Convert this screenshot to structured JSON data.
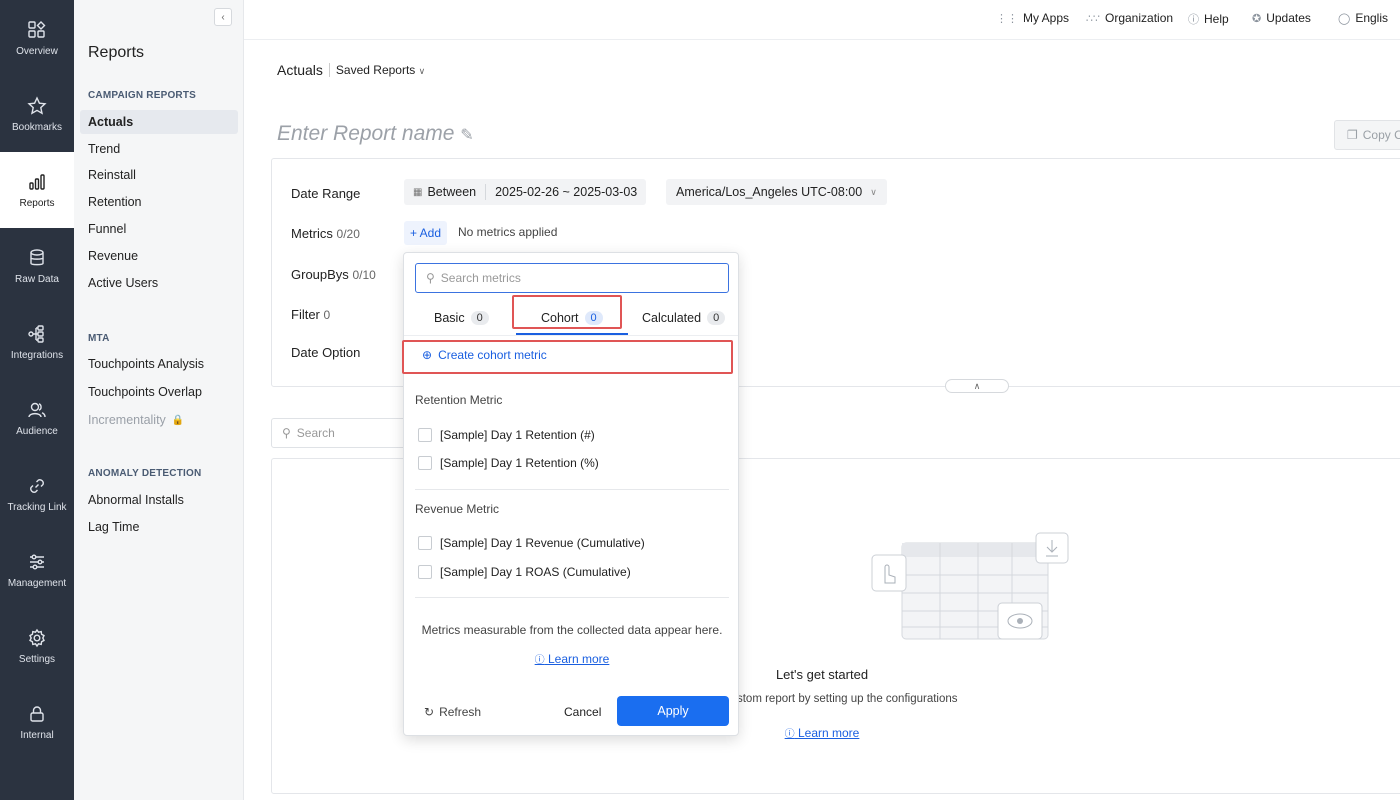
{
  "rail": {
    "items": [
      {
        "label": "Overview",
        "icon": "overview-icon"
      },
      {
        "label": "Bookmarks",
        "icon": "star-icon"
      },
      {
        "label": "Reports",
        "icon": "bar-chart-icon"
      },
      {
        "label": "Raw Data",
        "icon": "database-icon"
      },
      {
        "label": "Integrations",
        "icon": "integrations-icon"
      },
      {
        "label": "Audience",
        "icon": "audience-icon"
      },
      {
        "label": "Tracking Link",
        "icon": "link-icon"
      },
      {
        "label": "Management",
        "icon": "sliders-icon"
      },
      {
        "label": "Settings",
        "icon": "gear-icon"
      },
      {
        "label": "Internal",
        "icon": "lock-icon"
      }
    ]
  },
  "subnav": {
    "title": "Reports",
    "campaign_section": "CAMPAIGN REPORTS",
    "campaign_items": [
      "Actuals",
      "Trend",
      "Reinstall",
      "Retention",
      "Funnel",
      "Revenue",
      "Active Users"
    ],
    "mta_section": "MTA",
    "mta_items": [
      "Touchpoints Analysis",
      "Touchpoints Overlap",
      "Incrementality"
    ],
    "anomaly_section": "ANOMALY DETECTION",
    "anomaly_items": [
      "Abnormal Installs",
      "Lag Time"
    ]
  },
  "topbar": {
    "my_apps": "My Apps",
    "organization": "Organization",
    "help": "Help",
    "updates": "Updates",
    "language": "Englis"
  },
  "main": {
    "breadcrumb": "Actuals",
    "saved_reports": "Saved Reports",
    "report_name_placeholder": "Enter Report name",
    "copy_button": "Copy C",
    "date_range_label": "Date Range",
    "date_mode": "Between",
    "date_value": "2025-02-26 ~ 2025-03-03",
    "timezone": "America/Los_Angeles UTC-08:00",
    "metrics_label": "Metrics",
    "metrics_count": "0/20",
    "add_button": "+ Add",
    "no_metrics": "No metrics applied",
    "groupbys_label": "GroupBys",
    "groupbys_count": "0/10",
    "filter_label": "Filter",
    "filter_count": "0",
    "date_option_label": "Date Option",
    "search_placeholder": "Search",
    "empty_title": "Let's get started",
    "empty_sub": "Build a custom report by setting up the configurations",
    "empty_link": "Learn more"
  },
  "popup": {
    "search_placeholder": "Search metrics",
    "tabs": [
      {
        "label": "Basic",
        "count": "0"
      },
      {
        "label": "Cohort",
        "count": "0"
      },
      {
        "label": "Calculated",
        "count": "0"
      }
    ],
    "create_link": "Create cohort metric",
    "groups": [
      {
        "title": "Retention Metric",
        "items": [
          "[Sample] Day 1 Retention (#)",
          "[Sample] Day 1 Retention (%)"
        ]
      },
      {
        "title": "Revenue Metric",
        "items": [
          "[Sample] Day 1 Revenue (Cumulative)",
          "[Sample] Day 1 ROAS (Cumulative)"
        ]
      }
    ],
    "note": "Metrics measurable from the collected data appear here.",
    "learn_more": "Learn more",
    "refresh": "Refresh",
    "cancel": "Cancel",
    "apply": "Apply"
  },
  "colors": {
    "rail_bg": "#2b3340",
    "accent": "#1a6ef0",
    "highlight": "#e05555"
  }
}
